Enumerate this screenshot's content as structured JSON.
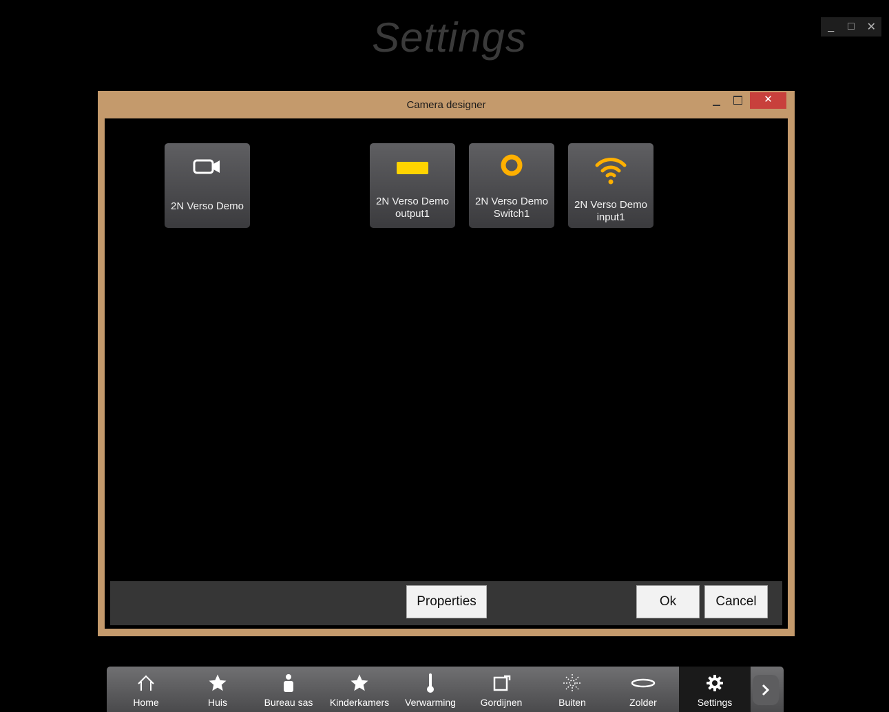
{
  "app": {
    "title": "Settings",
    "window_controls": {
      "minimize": "_",
      "maximize": "□",
      "close": "✕"
    }
  },
  "dialog": {
    "title": "Camera designer",
    "close_glyph": "✕",
    "tiles": [
      {
        "line1": "2N Verso Demo",
        "line2": "",
        "icon": "video-camera-icon",
        "icon_color": "#ffffff"
      },
      {
        "line1": "2N Verso Demo",
        "line2": "output1",
        "icon": "output-bar-icon",
        "icon_color": "#ffd400"
      },
      {
        "line1": "2N Verso Demo",
        "line2": "Switch1",
        "icon": "switch-ring-icon",
        "icon_color": "#ffb000"
      },
      {
        "line1": "2N Verso Demo",
        "line2": "input1",
        "icon": "wifi-icon",
        "icon_color": "#ffb000"
      }
    ],
    "buttons": {
      "properties": "Properties",
      "ok": "Ok",
      "cancel": "Cancel"
    }
  },
  "nav": {
    "items": [
      {
        "label": "Home",
        "icon": "home-icon"
      },
      {
        "label": "Huis",
        "icon": "star-icon"
      },
      {
        "label": "Bureau sas",
        "icon": "person-icon"
      },
      {
        "label": "Kinderkamers",
        "icon": "star-icon"
      },
      {
        "label": "Verwarming",
        "icon": "thermometer-icon"
      },
      {
        "label": "Gordijnen",
        "icon": "curtain-icon"
      },
      {
        "label": "Buiten",
        "icon": "sun-icon"
      },
      {
        "label": "Zolder",
        "icon": "ellipse-icon"
      },
      {
        "label": "Settings",
        "icon": "gear-icon"
      }
    ],
    "active": "Settings",
    "next_icon": "chevron-right-icon"
  }
}
